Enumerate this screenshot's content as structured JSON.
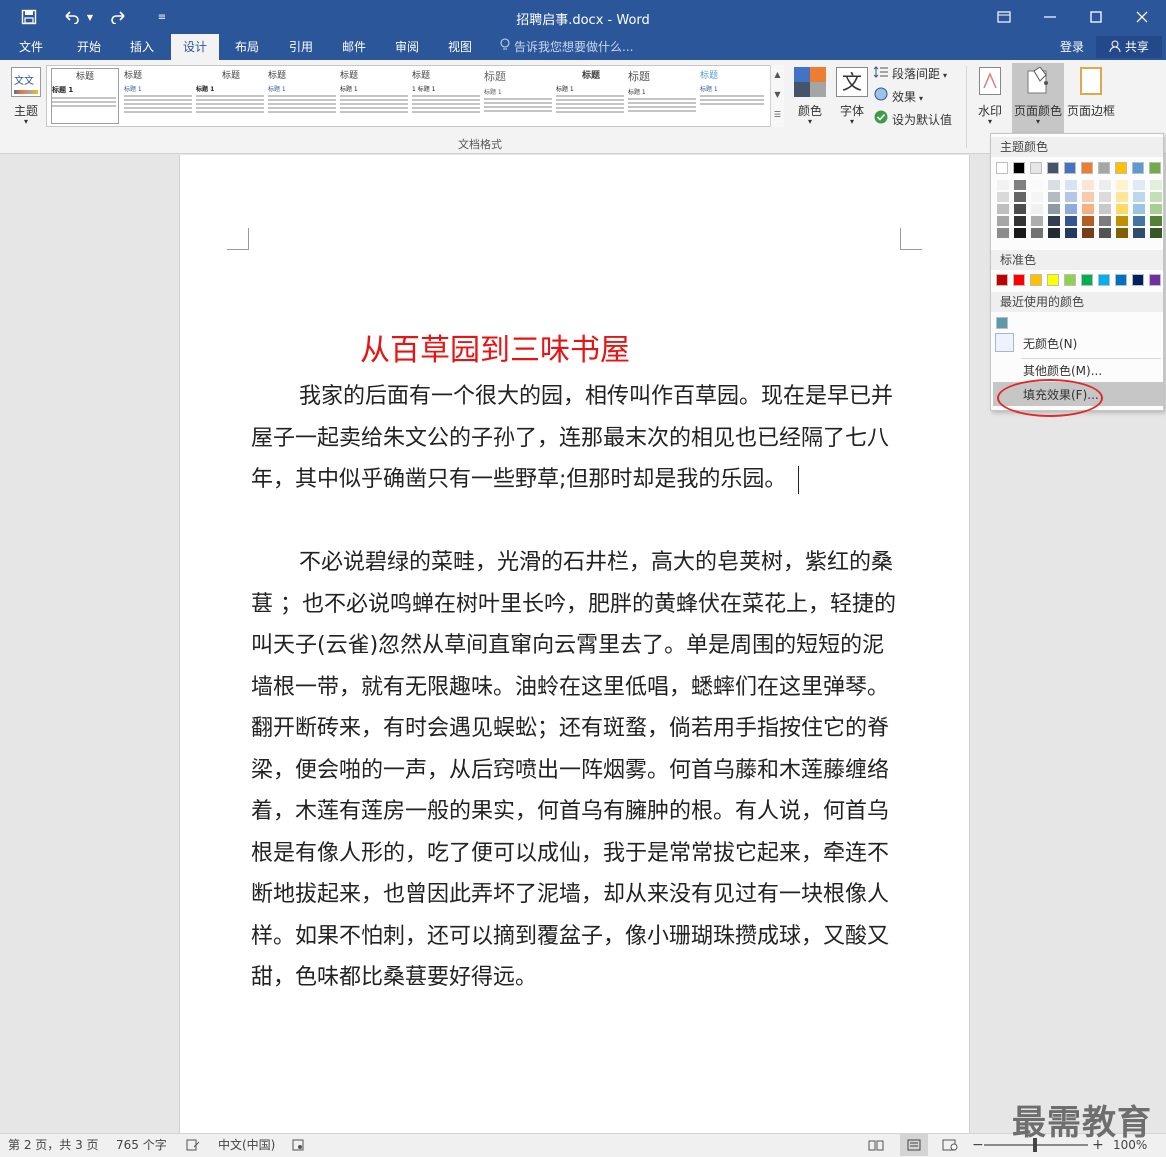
{
  "titlebar": {
    "title": "招聘启事.docx - Word",
    "save_icon": "save-icon",
    "undo_icon": "undo-icon",
    "redo_icon": "redo-icon",
    "customize_icon": "customize-qat-icon"
  },
  "tabs": [
    {
      "label": "文件"
    },
    {
      "label": "开始"
    },
    {
      "label": "插入"
    },
    {
      "label": "设计"
    },
    {
      "label": "布局"
    },
    {
      "label": "引用"
    },
    {
      "label": "邮件"
    },
    {
      "label": "审阅"
    },
    {
      "label": "视图"
    }
  ],
  "active_tab": "设计",
  "tell_me": "告诉我您想要做什么...",
  "account": {
    "login": "登录",
    "share": "共享"
  },
  "ribbon": {
    "theme_label": "主题",
    "style_gallery": [
      {
        "title": "标题",
        "heading": "标题 1"
      },
      {
        "title": "标题",
        "heading": "标题 1"
      },
      {
        "title": "标题",
        "heading": "标题 1"
      },
      {
        "title": "标题",
        "heading": "标题 1"
      },
      {
        "title": "标题",
        "heading": "标题 1"
      },
      {
        "title": "标题",
        "heading": "1 标题 1"
      },
      {
        "title": "标题",
        "heading": "标题 1"
      },
      {
        "title": "标题",
        "heading": "标题 1"
      },
      {
        "title": "标题",
        "heading": "标题 1"
      },
      {
        "title": "标题",
        "heading": "标题 1"
      }
    ],
    "gallery_group_label": "文档格式",
    "colors_label": "颜色",
    "fonts_label": "字体",
    "paragraph_spacing_label": "段落间距",
    "effects_label": "效果",
    "set_default_label": "设为默认值",
    "watermark_label": "水印",
    "page_color_label": "页面颜色",
    "page_border_label": "页面边框"
  },
  "dropdown": {
    "theme_colors_heading": "主题颜色",
    "standard_colors_heading": "标准色",
    "recent_colors_heading": "最近使用的颜色",
    "no_color": "无颜色(N)",
    "more_colors": "其他颜色(M)...",
    "fill_effects": "填充效果(F)...",
    "theme_colors": [
      "#ffffff",
      "#000000",
      "#e7e6e6",
      "#44546a",
      "#4472c4",
      "#ed7d31",
      "#a5a5a5",
      "#ffc000",
      "#5b9bd5",
      "#70ad47"
    ],
    "standard_colors": [
      "#c00000",
      "#ff0000",
      "#ffc000",
      "#ffff00",
      "#92d050",
      "#00b050",
      "#00b0f0",
      "#0070c0",
      "#002060",
      "#7030a0"
    ],
    "recent_colors": [
      "#5b9aa8"
    ]
  },
  "document": {
    "title": "从百草园到三味书屋",
    "paragraphs": [
      "我家的后面有一个很大的园，相传叫作百草园。现在是早已并屋子一起卖给朱文公的子孙了，连那最末次的相见也已经隔了七八年，其中似乎确凿只有一些野草;但那时却是我的乐园。",
      "不必说碧绿的菜畦，光滑的石井栏，高大的皂荚树，紫红的桑葚 ；也不必说鸣蝉在树叶里长吟，肥胖的黄蜂伏在菜花上，轻捷的叫天子(云雀)忽然从草间直窜向云霄里去了。单是周围的短短的泥墙根一带，就有无限趣味。油蛉在这里低唱，蟋蟀们在这里弹琴。翻开断砖来，有时会遇见蜈蚣；还有斑蝥，倘若用手指按住它的脊梁，便会啪的一声，从后窍喷出一阵烟雾。何首乌藤和木莲藤缠络着，木莲有莲房一般的果实，何首乌有臃肿的根。有人说，何首乌根是有像人形的，吃了便可以成仙，我于是常常拔它起来，牵连不断地拔起来，也曾因此弄坏了泥墙，却从来没有见过有一块根像人样。如果不怕刺，还可以摘到覆盆子，像小珊瑚珠攒成球，又酸又甜，色味都比桑葚要好得远。"
    ]
  },
  "statusbar": {
    "page": "第 2 页，共 3 页",
    "words": "765 个字",
    "language": "中文(中国)",
    "zoom": "100%"
  },
  "watermark_text": "最需教育"
}
